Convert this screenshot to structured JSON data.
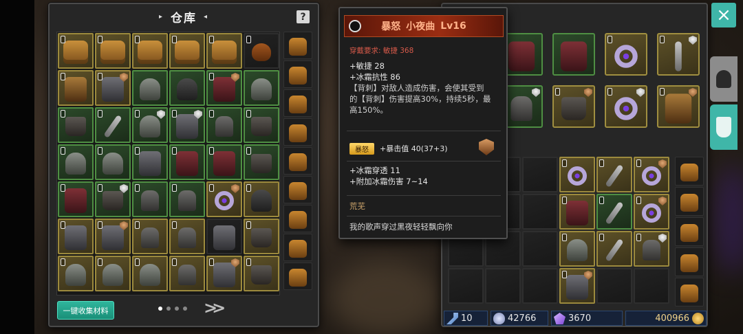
{
  "warehouse": {
    "title": "仓库",
    "help_icon": "?",
    "collect_button": "一键收集材料",
    "pages": 4,
    "active_page": 1,
    "next_icon": ">>",
    "slots": [
      {
        "q": "gold",
        "item": "chest",
        "lock": true
      },
      {
        "q": "gold",
        "item": "chest",
        "lock": true
      },
      {
        "q": "gold",
        "item": "chest",
        "lock": true
      },
      {
        "q": "gold",
        "item": "chest",
        "lock": true
      },
      {
        "q": "gold",
        "item": "chest",
        "lock": true
      },
      {
        "q": "dark",
        "item": "bag",
        "lock": true
      },
      {
        "q": "gold",
        "item": "armor-gold",
        "lock": true
      },
      {
        "q": "gold",
        "item": "armor-gray",
        "lock": true,
        "badge": "bronze"
      },
      {
        "q": "green",
        "item": "helm",
        "lock": false
      },
      {
        "q": "green",
        "item": "helm-dark",
        "lock": false
      },
      {
        "q": "green",
        "item": "armor",
        "lock": true,
        "badge": "bronze"
      },
      {
        "q": "green",
        "item": "helm",
        "lock": false
      },
      {
        "q": "green",
        "item": "boots",
        "lock": true
      },
      {
        "q": "green",
        "item": "blade",
        "lock": true
      },
      {
        "q": "green",
        "item": "helm",
        "lock": true,
        "badge": "silver"
      },
      {
        "q": "green",
        "item": "armor-gray",
        "lock": true,
        "badge": "silver"
      },
      {
        "q": "green",
        "item": "glove",
        "lock": true
      },
      {
        "q": "green",
        "item": "boots",
        "lock": true
      },
      {
        "q": "green",
        "item": "helm",
        "lock": true
      },
      {
        "q": "green",
        "item": "helm",
        "lock": true
      },
      {
        "q": "green",
        "item": "armor-gray",
        "lock": true
      },
      {
        "q": "green",
        "item": "armor",
        "lock": true
      },
      {
        "q": "green",
        "item": "armor",
        "lock": true
      },
      {
        "q": "green",
        "item": "boots",
        "lock": true
      },
      {
        "q": "green",
        "item": "armor",
        "lock": true
      },
      {
        "q": "green",
        "item": "boots",
        "lock": true,
        "badge": "silver"
      },
      {
        "q": "green",
        "item": "glove",
        "lock": true
      },
      {
        "q": "green",
        "item": "glove",
        "lock": true
      },
      {
        "q": "gold",
        "item": "ring",
        "lock": true,
        "badge": "bronze"
      },
      {
        "q": "gold",
        "item": "helm-dark",
        "lock": true
      },
      {
        "q": "gold",
        "item": "armor-gray",
        "lock": true
      },
      {
        "q": "gold",
        "item": "armor-gray",
        "lock": true,
        "badge": "bronze"
      },
      {
        "q": "gold",
        "item": "glove",
        "lock": true
      },
      {
        "q": "gold",
        "item": "glove",
        "lock": true
      },
      {
        "q": "dark",
        "item": "armor-gray",
        "lock": false
      },
      {
        "q": "gold",
        "item": "boots",
        "lock": true
      },
      {
        "q": "gold",
        "item": "helm",
        "lock": true
      },
      {
        "q": "gold",
        "item": "helm",
        "lock": true
      },
      {
        "q": "gold",
        "item": "helm",
        "lock": true
      },
      {
        "q": "gold",
        "item": "glove",
        "lock": true
      },
      {
        "q": "gold",
        "item": "armor-gray",
        "lock": true,
        "badge": "bronze"
      },
      {
        "q": "gold",
        "item": "boots",
        "lock": true
      }
    ],
    "side_slots": 9
  },
  "tooltip": {
    "name_prefix": "暴怒",
    "name": "小夜曲",
    "level": "Lv16",
    "requirement_label": "穿戴要求:",
    "requirement_value": "敏捷 368",
    "stat_agility": "+敏捷 28",
    "stat_frost_res": "+冰霜抗性 86",
    "desc_1": "【背刺】对敌人造成伤害，会使其受到",
    "desc_2": "的【背刺】伤害提高30%，持续5秒，最",
    "desc_3": "高150%。",
    "tag": "暴怒",
    "crit_stat": "+暴击值 40(37+3)",
    "stat_frost_pen": "+冰霜穿透 11",
    "stat_frost_dmg": "+附加冰霜伤害 7~14",
    "set_name": "荒芜",
    "flavor": "我的歌声穿过黑夜轻轻飘向你"
  },
  "character": {
    "equip_row1": [
      {
        "q": "green",
        "item": "armor"
      },
      {
        "q": "green",
        "item": "armor"
      },
      {
        "q": "gold",
        "item": "ring",
        "lock": true
      },
      {
        "q": "gold",
        "item": "blade",
        "lock": true,
        "badge": "silver"
      }
    ],
    "equip_row2": [
      {
        "q": "green",
        "item": "glove",
        "badge": "silver"
      },
      {
        "q": "gold",
        "item": "boots",
        "lock": true,
        "badge": "bronze"
      },
      {
        "q": "gold",
        "item": "ring",
        "lock": true,
        "badge": "silver"
      },
      {
        "q": "gold",
        "item": "armor-gold",
        "lock": true,
        "badge": "bronze"
      }
    ],
    "inventory": [
      {
        "q": "dark"
      },
      {
        "q": "dark"
      },
      {
        "q": "dark"
      },
      {
        "q": "gold",
        "item": "ring",
        "lock": true
      },
      {
        "q": "gold",
        "item": "blade",
        "lock": true
      },
      {
        "q": "gold",
        "item": "ring",
        "lock": true,
        "badge": "bronze"
      },
      {
        "q": "dark"
      },
      {
        "q": "dark"
      },
      {
        "q": "dark"
      },
      {
        "q": "gold",
        "item": "armor",
        "lock": true
      },
      {
        "q": "green",
        "item": "blade",
        "lock": true
      },
      {
        "q": "gold",
        "item": "ring",
        "lock": true,
        "badge": "bronze"
      },
      {
        "q": "dark"
      },
      {
        "q": "dark"
      },
      {
        "q": "dark"
      },
      {
        "q": "gold",
        "item": "helm",
        "lock": true
      },
      {
        "q": "gold",
        "item": "blade",
        "lock": true
      },
      {
        "q": "gold",
        "item": "glove",
        "lock": true,
        "badge": "silver"
      },
      {
        "q": "dark"
      },
      {
        "q": "dark"
      },
      {
        "q": "dark"
      },
      {
        "q": "gold",
        "item": "armor-gray",
        "lock": true,
        "badge": "bronze"
      },
      {
        "q": "dark"
      },
      {
        "q": "dark"
      }
    ],
    "inventory_side": 5
  },
  "status": {
    "keys": "10",
    "shield_value": "42766",
    "gems": "3670",
    "gold": "400966"
  },
  "close_icon": "×"
}
